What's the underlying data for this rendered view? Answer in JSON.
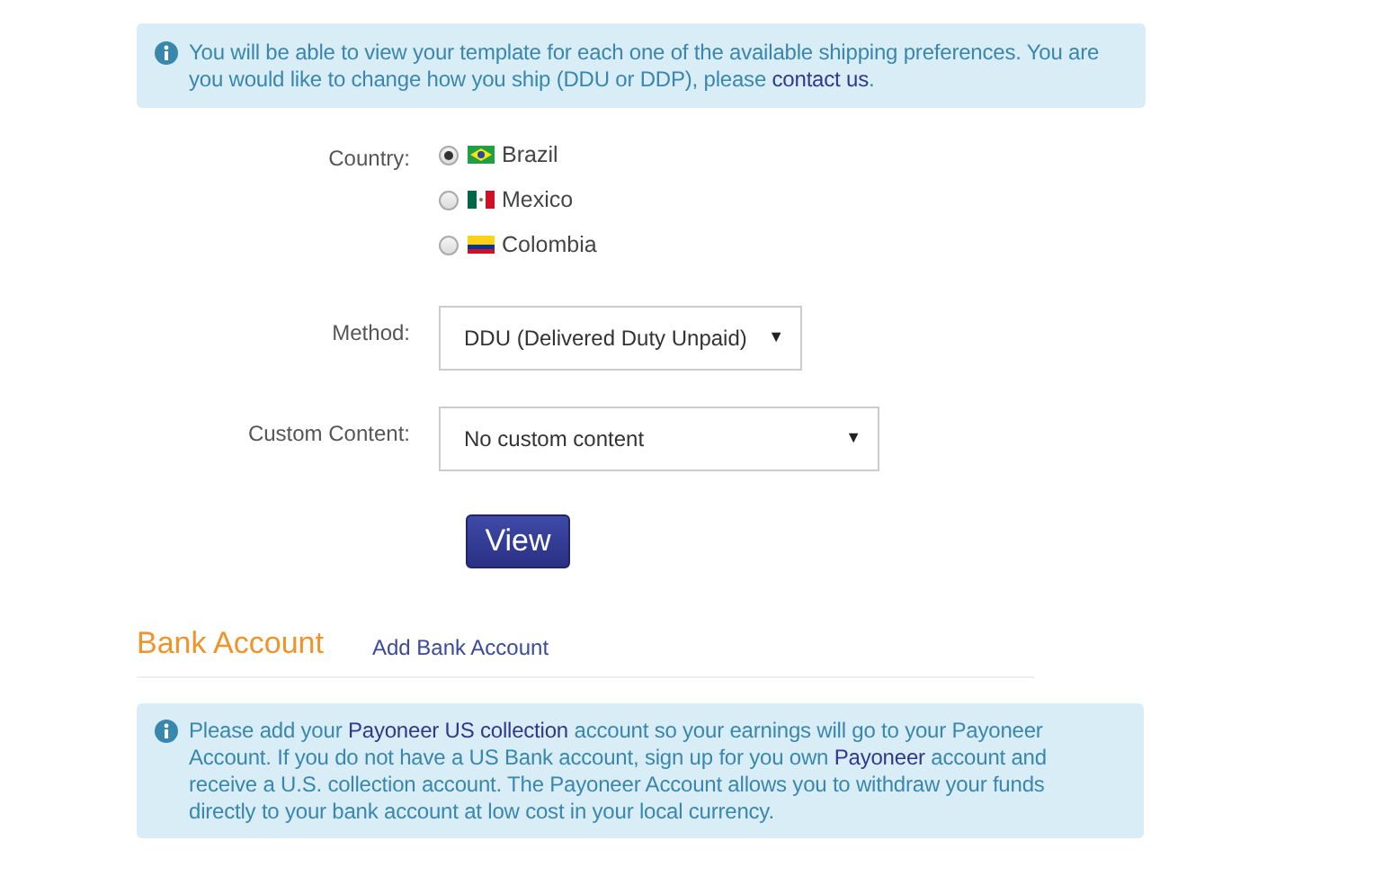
{
  "shipping_notice": {
    "lines": [
      [
        {
          "kind": "text",
          "text": "You will be able to view your template for each one of the available shipping preferences. You are"
        }
      ],
      [
        {
          "kind": "text",
          "text": "you would like to change how you ship (DDU or DDP), please "
        },
        {
          "kind": "link",
          "text": "contact us"
        },
        {
          "kind": "text",
          "text": "."
        }
      ]
    ]
  },
  "country": {
    "label": "Country:",
    "options": [
      {
        "label": "Brazil",
        "selected": true
      },
      {
        "label": "Mexico",
        "selected": false
      },
      {
        "label": "Colombia",
        "selected": false
      }
    ]
  },
  "method": {
    "label": "Method:",
    "value": "DDU (Delivered Duty Unpaid)",
    "caret": "▼"
  },
  "custom_content": {
    "label": "Custom Content:",
    "value": "No custom content",
    "caret": "▼"
  },
  "view_button": "View",
  "bank_account": {
    "title": "Bank Account",
    "add_link": "Add Bank Account"
  },
  "bank_notice": {
    "lines": [
      [
        {
          "kind": "text",
          "text": "Please add your "
        },
        {
          "kind": "link",
          "text": "Payoneer US collection"
        },
        {
          "kind": "text",
          "text": " account so your earnings will go to your Payoneer"
        }
      ],
      [
        {
          "kind": "text",
          "text": "Account. If you do not have a US Bank account, sign up for you own "
        },
        {
          "kind": "link",
          "text": "Payoneer"
        },
        {
          "kind": "text",
          "text": " account and"
        }
      ],
      [
        {
          "kind": "text",
          "text": "receive a U.S. collection account. The Payoneer Account allows you to withdraw your funds"
        }
      ],
      [
        {
          "kind": "text",
          "text": "directly to your bank account at low cost in your local currency."
        }
      ]
    ]
  }
}
